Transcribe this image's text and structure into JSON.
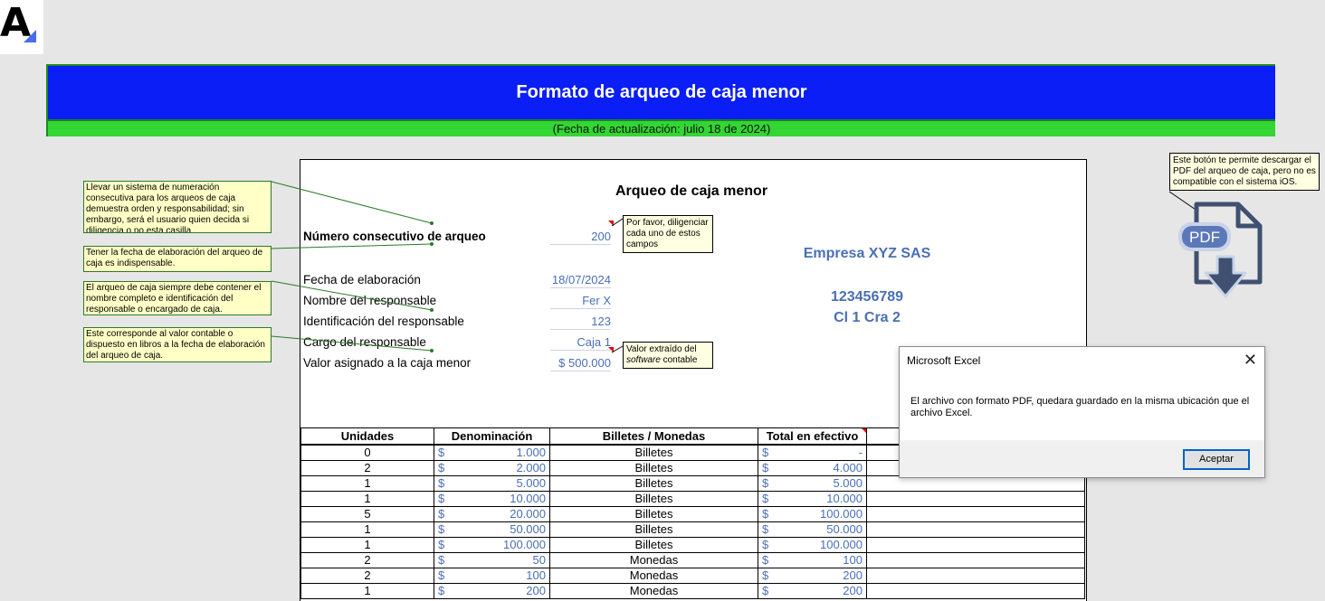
{
  "header": {
    "title": "Formato de arqueo de caja menor",
    "subtitle": "(Fecha de actualización: julio 18 de 2024)"
  },
  "sheet": {
    "title": "Arqueo de caja menor",
    "fields": [
      {
        "label": "Número consecutivo de arqueo",
        "value": "200"
      },
      {
        "label": "Fecha de elaboración",
        "value": "18/07/2024"
      },
      {
        "label": "Nombre del responsable",
        "value": "Fer X"
      },
      {
        "label": "Identificación del responsable",
        "value": "123"
      },
      {
        "label": "Cargo del responsable",
        "value": "Caja 1"
      },
      {
        "label": "Valor asignado a la caja menor",
        "value": "$ 500.000"
      }
    ],
    "company": {
      "name": "Empresa XYZ SAS",
      "id": "123456789",
      "address": "Cl 1 Cra 2"
    }
  },
  "comments": {
    "consecutivo": "Llevar un sistema de numeración consecutiva para los arqueos de caja demuestra orden y responsabilidad; sin embargo, será el usuario quien decida si diligencia o no esta casilla",
    "fecha": "Tener la fecha de elaboración del arqueo de caja es indispensable.",
    "responsable": "El arqueo de caja siempre debe contener el nombre completo e identificación del responsable o encargado de caja.",
    "valor": "Este corresponde al valor contable o dispuesto en libros a la fecha de elaboración del arqueo de caja.",
    "diligenciar": "Por favor, diligenciar cada uno de estos campos",
    "software_pre": "Valor extraído del",
    "software_word": "software",
    "software_post": "contable",
    "pdf": "Este botón te permite descargar el PDF del arqueo de caja, pero no es compatible con el sistema iOS."
  },
  "pdf_button": {
    "label": "PDF",
    "icon": "pdf-download-icon"
  },
  "table": {
    "headers": [
      "Unidades",
      "Denominación",
      "Billetes / Monedas",
      "Total en efectivo"
    ],
    "currency": "$",
    "rows": [
      {
        "units": "0",
        "denom": "1.000",
        "type": "Billetes",
        "total": "-"
      },
      {
        "units": "2",
        "denom": "2.000",
        "type": "Billetes",
        "total": "4.000"
      },
      {
        "units": "1",
        "denom": "5.000",
        "type": "Billetes",
        "total": "5.000"
      },
      {
        "units": "1",
        "denom": "10.000",
        "type": "Billetes",
        "total": "10.000"
      },
      {
        "units": "5",
        "denom": "20.000",
        "type": "Billetes",
        "total": "100.000"
      },
      {
        "units": "1",
        "denom": "50.000",
        "type": "Billetes",
        "total": "50.000"
      },
      {
        "units": "1",
        "denom": "100.000",
        "type": "Billetes",
        "total": "100.000"
      },
      {
        "units": "2",
        "denom": "50",
        "type": "Monedas",
        "total": "100"
      },
      {
        "units": "2",
        "denom": "100",
        "type": "Monedas",
        "total": "200"
      },
      {
        "units": "1",
        "denom": "200",
        "type": "Monedas",
        "total": "200"
      }
    ]
  },
  "dialog": {
    "title": "Microsoft Excel",
    "message": "El archivo con formato PDF, quedara guardado en la misma ubicación que el archivo Excel.",
    "ok_label": "Aceptar"
  }
}
